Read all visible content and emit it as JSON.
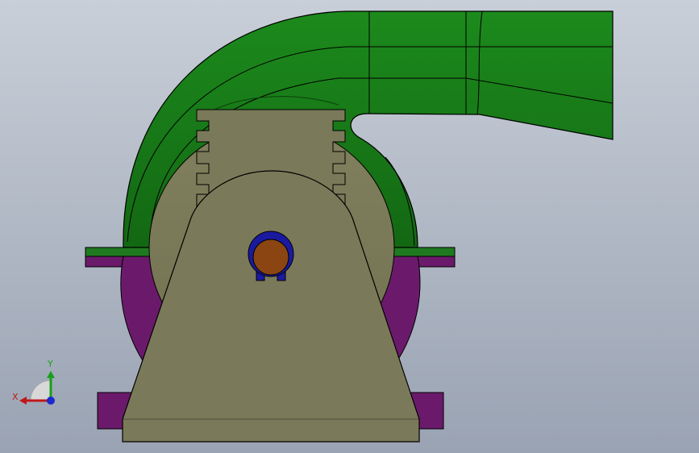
{
  "viewport": {
    "background_top": "#c9cfd8",
    "background_bottom": "#9aa3b3"
  },
  "model": {
    "colors": {
      "duct": "#1f7a1f",
      "duct_dark": "#0f4f0f",
      "housing": "#6b1a6b",
      "body": "#7a7a5a",
      "shaft": "#8a4512",
      "shaft_ring": "#1a1aa0",
      "outline": "#000000"
    }
  },
  "triad": {
    "x_label": "X",
    "y_label": "Y",
    "x_color": "#c01818",
    "y_color": "#18a018",
    "z_color": "#1a2acc",
    "icon": "coordinate-triad-icon"
  }
}
